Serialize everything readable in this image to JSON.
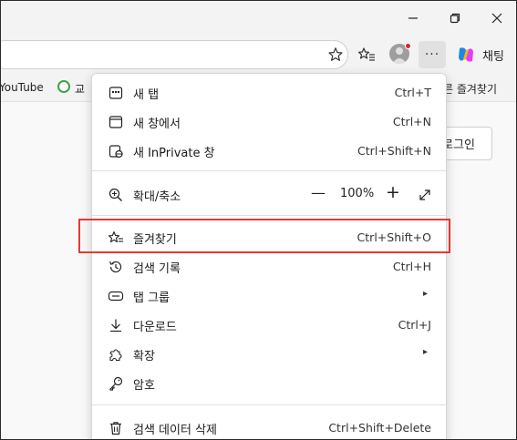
{
  "titlebar": {
    "minimize_icon": "minimize-icon",
    "restore_icon": "restore-icon",
    "close_icon": "close-icon"
  },
  "toolbar": {
    "more_label": "···",
    "chat_label": "채팅"
  },
  "favorites_bar": {
    "items": [
      {
        "label": "YouTube"
      },
      {
        "label": "교"
      },
      {
        "label": "른 즐겨찾기"
      }
    ]
  },
  "page": {
    "login_label": "로그인"
  },
  "menu": {
    "items": [
      {
        "label": "새 탭",
        "shortcut": "Ctrl+T",
        "icon": "new-tab-icon"
      },
      {
        "label": "새 창에서",
        "shortcut": "Ctrl+N",
        "icon": "new-window-icon"
      },
      {
        "label": "새 InPrivate 창",
        "shortcut": "Ctrl+Shift+N",
        "icon": "inprivate-icon"
      },
      {
        "label": "확대/축소",
        "icon": "zoom-icon",
        "zoom_minus": "—",
        "zoom_value": "100%",
        "zoom_plus": "+"
      },
      {
        "label": "즐겨찾기",
        "shortcut": "Ctrl+Shift+O",
        "icon": "favorites-icon"
      },
      {
        "label": "검색 기록",
        "shortcut": "Ctrl+H",
        "icon": "history-icon"
      },
      {
        "label": "탭 그룹",
        "icon": "tab-groups-icon",
        "submenu": "▸"
      },
      {
        "label": "다운로드",
        "shortcut": "Ctrl+J",
        "icon": "download-icon"
      },
      {
        "label": "확장",
        "icon": "extensions-icon",
        "submenu": "▸"
      },
      {
        "label": "암호",
        "icon": "password-icon"
      },
      {
        "label": "검색 데이터 삭제",
        "shortcut": "Ctrl+Shift+Delete",
        "icon": "delete-data-icon"
      }
    ]
  },
  "colors": {
    "highlight": "#e53935",
    "menu_bg": "#ffffff",
    "chrome_bg": "#f3f3f3"
  }
}
